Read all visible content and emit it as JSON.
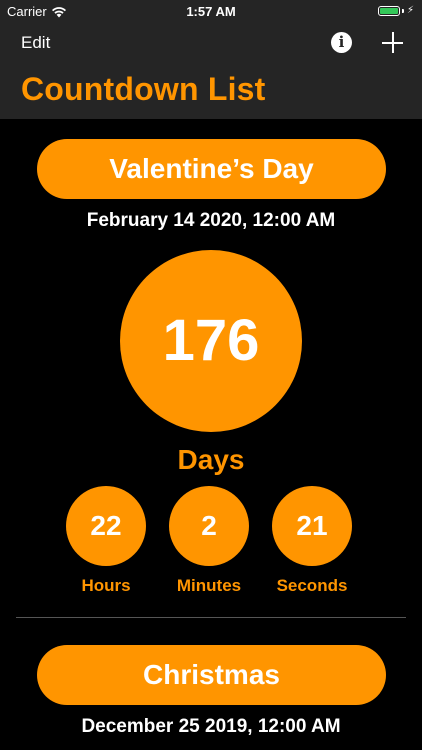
{
  "status_bar": {
    "carrier": "Carrier",
    "time": "1:57 AM",
    "battery_level": 1.0
  },
  "nav": {
    "edit_label": "Edit",
    "info_label": "i",
    "add_icon": "plus-icon",
    "title": "Countdown List"
  },
  "colors": {
    "accent": "#ff9500",
    "nav_background": "#252525",
    "background": "#000000"
  },
  "events": [
    {
      "name": "Valentine’s Day",
      "date": "February 14 2020, 12:00 AM",
      "days": "176",
      "days_label": "Days",
      "hours": "22",
      "hours_label": "Hours",
      "minutes": "2",
      "minutes_label": "Minutes",
      "seconds": "21",
      "seconds_label": "Seconds"
    },
    {
      "name": "Christmas",
      "date": "December 25 2019, 12:00 AM"
    }
  ]
}
